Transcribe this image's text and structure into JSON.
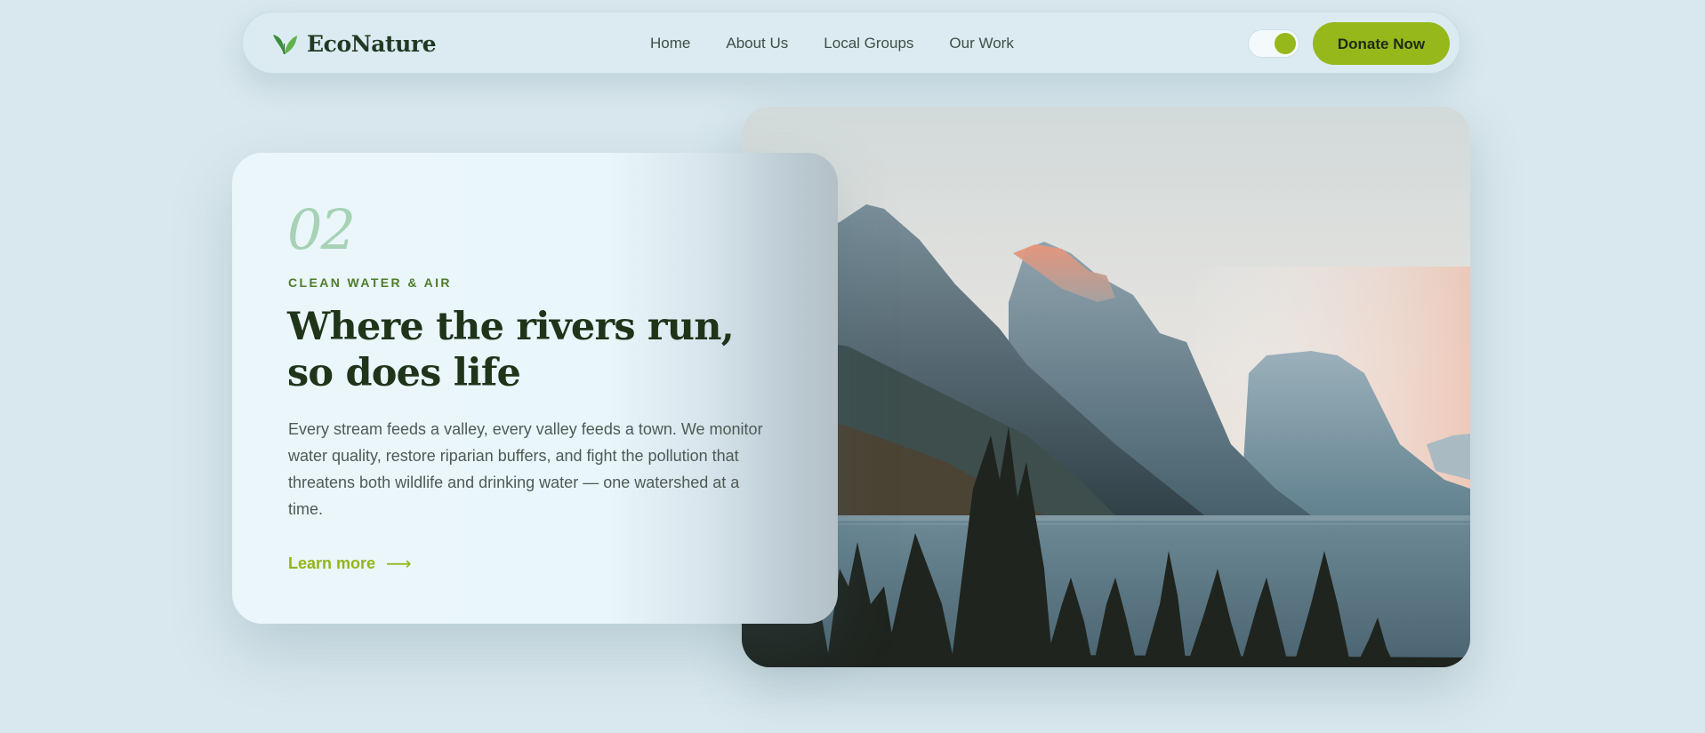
{
  "brand": {
    "name": "EcoNature",
    "icon": "leaf-icon"
  },
  "nav": {
    "links": [
      "Home",
      "About Us",
      "Local Groups",
      "Our Work"
    ],
    "toggle_on": true,
    "donate_label": "Donate Now"
  },
  "hero": {
    "number": "02",
    "eyebrow": "CLEAN WATER & AIR",
    "title": "Where the rivers run, so does life",
    "body": "Every stream feeds a valley, every valley feeds a town. We monitor water quality, restore riparian buffers, and fight the pollution that threatens both wildlife and drinking water — one watershed at a time.",
    "link_label": "Learn more",
    "link_icon": "arrow-right-icon"
  },
  "colors": {
    "background": "#d9e8ee",
    "accent": "#96b81b",
    "heading": "#1f3419",
    "eyebrow": "#4f7b2c",
    "number": "#a6d2b5"
  },
  "image": {
    "subject": "mountain-lake-landscape"
  }
}
